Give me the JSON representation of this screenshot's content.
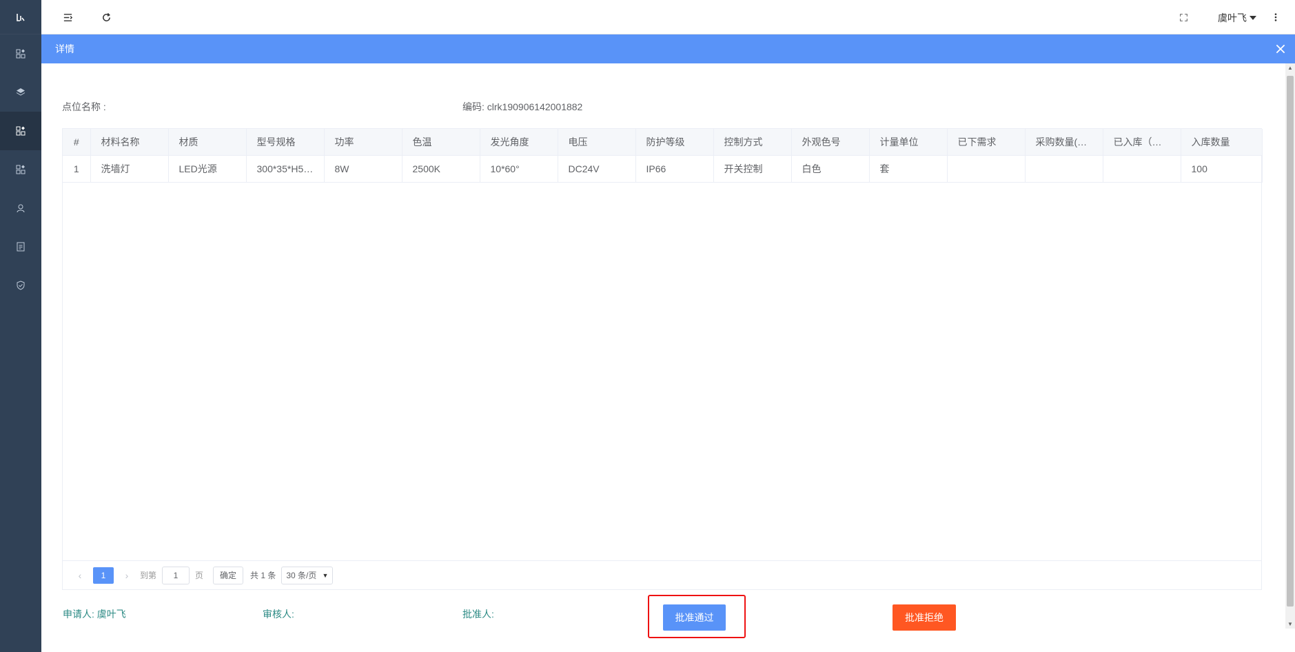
{
  "header": {
    "user_name": "虞叶飞"
  },
  "dialog": {
    "title": "详情",
    "point_name_label": "点位名称 :",
    "code_label": "编码:",
    "code_value": "clrk190906142001882"
  },
  "table": {
    "headers": [
      "#",
      "材料名称",
      "材质",
      "型号规格",
      "功率",
      "色温",
      "发光角度",
      "电压",
      "防护等级",
      "控制方式",
      "外观色号",
      "计量单位",
      "已下需求",
      "采购数量(…",
      "已入库（…",
      "入库数量"
    ],
    "rows": [
      [
        "1",
        "洗墙灯",
        "LED光源",
        "300*35*H5…",
        "8W",
        "2500K",
        "10*60°",
        "DC24V",
        "IP66",
        "开关控制",
        "白色",
        "套",
        "",
        "",
        "",
        "100"
      ]
    ]
  },
  "pagination": {
    "current_page": "1",
    "goto_label": "到第",
    "goto_value": "1",
    "page_label": "页",
    "confirm_label": "确定",
    "total_label": "共 1 条",
    "page_size": "30 条/页"
  },
  "footer": {
    "applicant": "申请人: 虞叶飞",
    "reviewer": "审核人:",
    "approver": "批准人:",
    "approve_label": "批准通过",
    "reject_label": "批准拒绝"
  },
  "colors": {
    "primary": "#5993f8",
    "reject": "#ff5722",
    "sidebar": "#304156",
    "footer_text": "#2b8a84",
    "highlight": "#ee1111"
  }
}
